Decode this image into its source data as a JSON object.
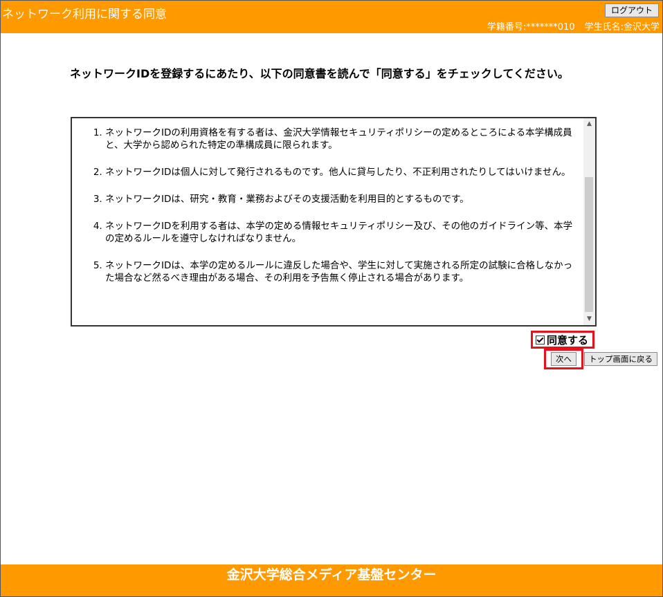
{
  "header": {
    "title": "ネットワーク利用に関する同意",
    "logout_label": "ログアウト",
    "student_id": "学籍番号:*******010",
    "student_name": "学生氏名:金沢大学"
  },
  "instruction": "ネットワークIDを登録するにあたり、以下の同意書を読んで「同意する」をチェックしてください。",
  "terms": [
    "ネットワークIDの利用資格を有する者は、金沢大学情報セキュリティポリシーの定めるところによる本学構成員と、大学から認められた特定の準構成員に限られます。",
    "ネットワークIDは個人に対して発行されるものです。他人に貸与したり、不正利用されたりしてはいけません。",
    "ネットワークIDは、研究・教育・業務およびその支援活動を利用目的とするものです。",
    "ネットワークIDを利用する者は、本学の定める情報セキュリティポリシー及び、その他のガイドライン等、本学の定めるルールを遵守しなければなりません。",
    "ネットワークIDは、本学の定めるルールに違反した場合や、学生に対して実施される所定の試験に合格しなかった場合など然るべき理由がある場合、その利用を予告無く停止される場合があります。"
  ],
  "agree": {
    "label": "同意する",
    "checked": true
  },
  "buttons": {
    "next_label": "次へ",
    "top_label": "トップ画面に戻る"
  },
  "footer": {
    "text": "金沢大学総合メディア基盤センター"
  },
  "colors": {
    "brand": "#ff9900",
    "highlight": "#e8101a"
  }
}
